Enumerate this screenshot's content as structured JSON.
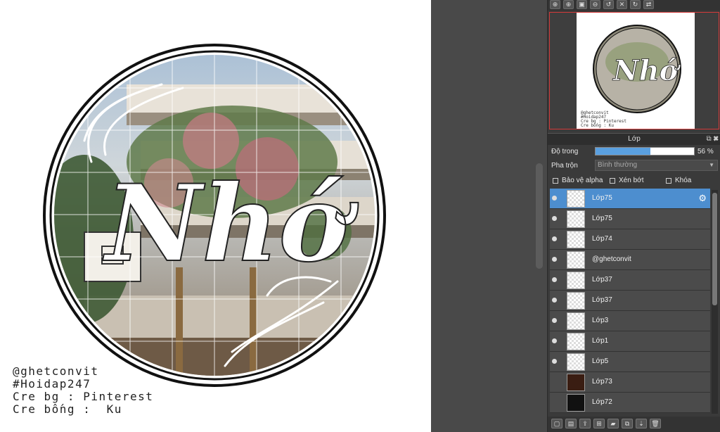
{
  "artwork": {
    "title_text": "Nhớ",
    "credits": [
      "@ghetconvit",
      "#Hoidap247",
      "Cre bg : Pinterest",
      "Cre bống :  Ku"
    ]
  },
  "toolbar": {
    "icons": [
      "zoom-in-icon",
      "zoom-in-icon",
      "fit-icon",
      "zoom-out-icon",
      "rotate-left-icon",
      "reset-icon",
      "rotate-right-icon",
      "flip-icon"
    ]
  },
  "layer_panel": {
    "title": "Lớp",
    "opacity_label": "Độ trong",
    "opacity_value": 56,
    "opacity_text": "56 %",
    "blend_label": "Pha trộn",
    "blend_value": "Bình thường",
    "checkboxes": [
      {
        "label": "Bảo vệ alpha",
        "checked": false
      },
      {
        "label": "Xén bớt",
        "checked": false
      },
      {
        "label": "Khóa",
        "checked": false
      }
    ],
    "layers": [
      {
        "name": "Lớp75",
        "visible": true,
        "selected": true,
        "thumb": "blank"
      },
      {
        "name": "Lớp75",
        "visible": true,
        "selected": false,
        "thumb": "blank"
      },
      {
        "name": "Lớp74",
        "visible": true,
        "selected": false,
        "thumb": "blank"
      },
      {
        "name": "@ghetconvit",
        "visible": true,
        "selected": false,
        "thumb": "text"
      },
      {
        "name": "Lớp37",
        "visible": true,
        "selected": false,
        "thumb": "blank"
      },
      {
        "name": "Lớp37",
        "visible": true,
        "selected": false,
        "thumb": "blank"
      },
      {
        "name": "Lớp3",
        "visible": true,
        "selected": false,
        "thumb": "circle"
      },
      {
        "name": "Lớp1",
        "visible": true,
        "selected": false,
        "thumb": "blank"
      },
      {
        "name": "Lớp5",
        "visible": true,
        "selected": false,
        "thumb": "blank"
      },
      {
        "name": "Lớp73",
        "visible": false,
        "selected": false,
        "thumb": "dark"
      },
      {
        "name": "Lớp72",
        "visible": false,
        "selected": false,
        "thumb": "black"
      }
    ]
  },
  "colors": {
    "accent": "#4d8ecf",
    "selection_border": "#d43a3a",
    "panel_bg": "#3a3a3a"
  }
}
